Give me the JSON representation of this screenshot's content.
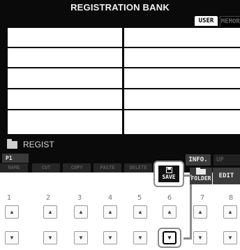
{
  "screen": {
    "title": "REGISTRATION BANK",
    "tabs": [
      "USER",
      "MEMORY"
    ],
    "folder_label": "REGIST",
    "page_tab": "P1"
  },
  "functions": {
    "name": "NAME",
    "cut": "CUT",
    "copy": "COPY",
    "paste": "PASTE",
    "delete": "DELETE",
    "save": "SAVE",
    "folder": "FOLDER",
    "info": "INFO.",
    "up": "UP",
    "edit": "EDIT"
  },
  "buttons": {
    "numbers": [
      "1",
      "2",
      "3",
      "4",
      "5",
      "6",
      "7",
      "8"
    ],
    "up_symbol": "▲",
    "down_symbol": "▼",
    "highlighted": "6-down"
  },
  "colors": {
    "screen_bg": "#0a0a0a",
    "cell_bg": "#ffffff",
    "highlight": "#8a8a8a"
  }
}
